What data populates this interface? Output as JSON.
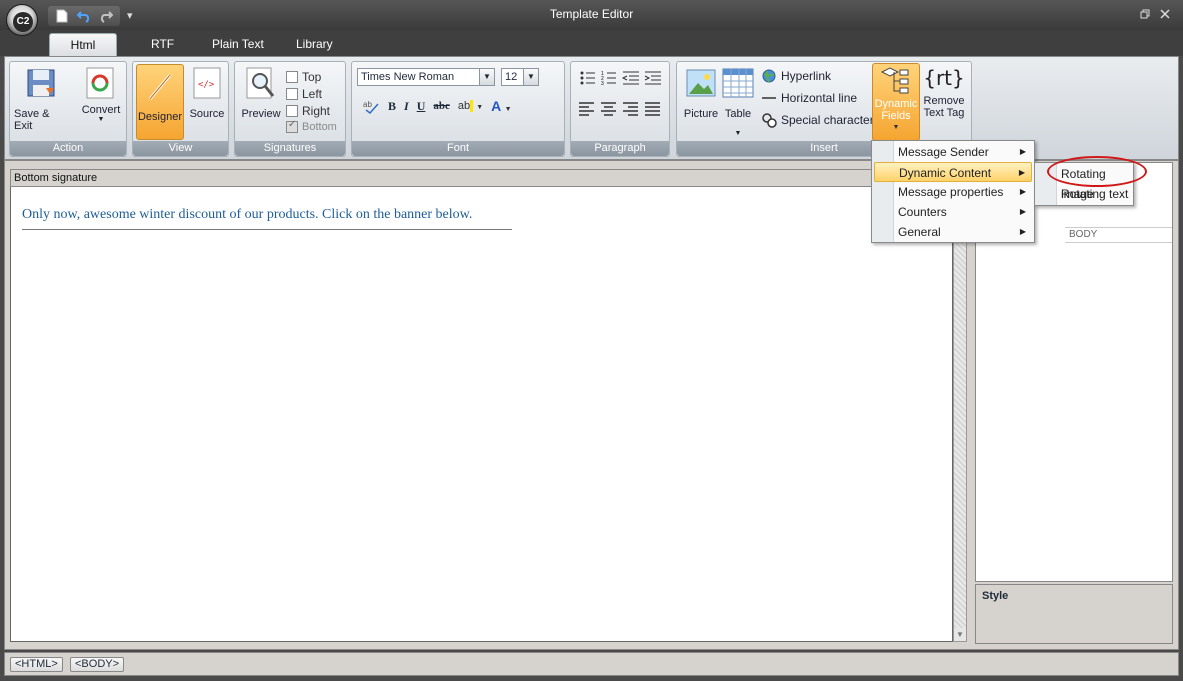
{
  "window": {
    "title": "Template Editor",
    "orb_label": "C2",
    "restore_icon": "restore-icon",
    "close_icon": "close-icon",
    "qat_more": "▾"
  },
  "tabs": [
    {
      "label": "Html"
    },
    {
      "label": "RTF"
    },
    {
      "label": "Plain Text"
    },
    {
      "label": "Library"
    }
  ],
  "ribbon": {
    "action": {
      "label": "Action",
      "save_exit": "Save & Exit",
      "convert": "Convert"
    },
    "view": {
      "label": "View",
      "designer": "Designer",
      "source": "Source"
    },
    "signatures": {
      "label": "Signatures",
      "preview": "Preview",
      "top": "Top",
      "left": "Left",
      "right": "Right",
      "bottom": "Bottom"
    },
    "font": {
      "label": "Font",
      "family": "Times New Roman",
      "size": "12",
      "bold": "B",
      "italic": "I",
      "underline": "U",
      "strike": "abc",
      "color": "A"
    },
    "paragraph": {
      "label": "Paragraph"
    },
    "insert": {
      "label": "Insert",
      "picture": "Picture",
      "table": "Table",
      "hyperlink": "Hyperlink",
      "horizontal_line": "Horizontal line",
      "special_character": "Special character",
      "dynamic_fields_1": "Dynamic",
      "dynamic_fields_2": "Fields",
      "remove_1": "Remove",
      "remove_2": "Text Tag",
      "rt": "{rt}"
    }
  },
  "editor": {
    "header": "Bottom signature",
    "content": "Only now, awesome winter discount of our products. Click on the banner below."
  },
  "side": {
    "body_label": "BODY",
    "style_label": "Style"
  },
  "status": {
    "crumbs": [
      "<HTML>",
      "<BODY>"
    ]
  },
  "dynamic_menu": {
    "items": [
      {
        "label": "Message Sender"
      },
      {
        "label": "Dynamic Content"
      },
      {
        "label": "Message properties"
      },
      {
        "label": "Counters"
      },
      {
        "label": "General"
      }
    ]
  },
  "dynamic_content_submenu": {
    "items": [
      {
        "label": "Rotating image"
      },
      {
        "label": "Rotating text"
      }
    ]
  }
}
